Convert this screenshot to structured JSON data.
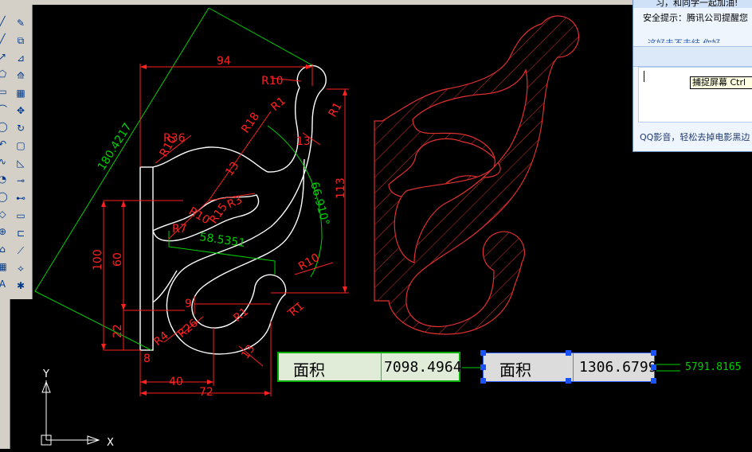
{
  "toolbar_modify": {
    "icons": [
      "erase-icon",
      "copy-icon",
      "mirror-icon",
      "offset-icon",
      "array-icon",
      "move-icon",
      "rotate-icon",
      "scale-icon",
      "stretch-icon",
      "trim-icon",
      "extend-icon",
      "break-icon",
      "break-at-point-icon",
      "chamfer-icon",
      "fillet-icon",
      "explode-icon"
    ]
  },
  "toolbar_draw": {
    "glyphs": [
      "╱",
      "╱",
      "↗",
      "⬠",
      "▭",
      "⌒",
      "◯",
      "↶",
      "∿",
      "◔",
      "◯",
      "◇",
      "⊕",
      "⌂",
      "▦",
      "A"
    ]
  },
  "qq": {
    "line1": "习，和同学一起加油!",
    "line2": "安全提示：腾讯公司提醒您",
    "line3": "这好去不去结    你好",
    "footer": "QQ影音，轻松去掉电影黑边",
    "tooltip": "捕捉屏幕 Ctrl"
  },
  "drawing": {
    "dims": {
      "d94": "94",
      "r10_top": "R10",
      "r1_top": "R1",
      "r1_right": "R1",
      "r18": "R18",
      "d13_top": "13",
      "d13_mid": "13",
      "angle": "66.910°",
      "aligned": "180.4217",
      "d113": "113",
      "r36": "R36",
      "r10_left": "R10",
      "r3": "R3",
      "r10_mid": "R10",
      "r15": "R15",
      "r7": "R7",
      "d58": "58.5351",
      "d100": "100",
      "d60": "60",
      "d22": "22",
      "r10_low": "R10",
      "d9": "9",
      "r1_low": "R1",
      "r1_low2": "R1",
      "r4": "R4",
      "r26": "R26",
      "d8": "8",
      "d13_low": "13",
      "d40": "40",
      "d72": "72"
    },
    "ucs": {
      "x": "X",
      "y": "Y"
    }
  },
  "area1": {
    "label": "面积",
    "value": "7098.4964"
  },
  "area2": {
    "label": "面积",
    "value": "1306.6799"
  },
  "result_value": "5791.8165"
}
